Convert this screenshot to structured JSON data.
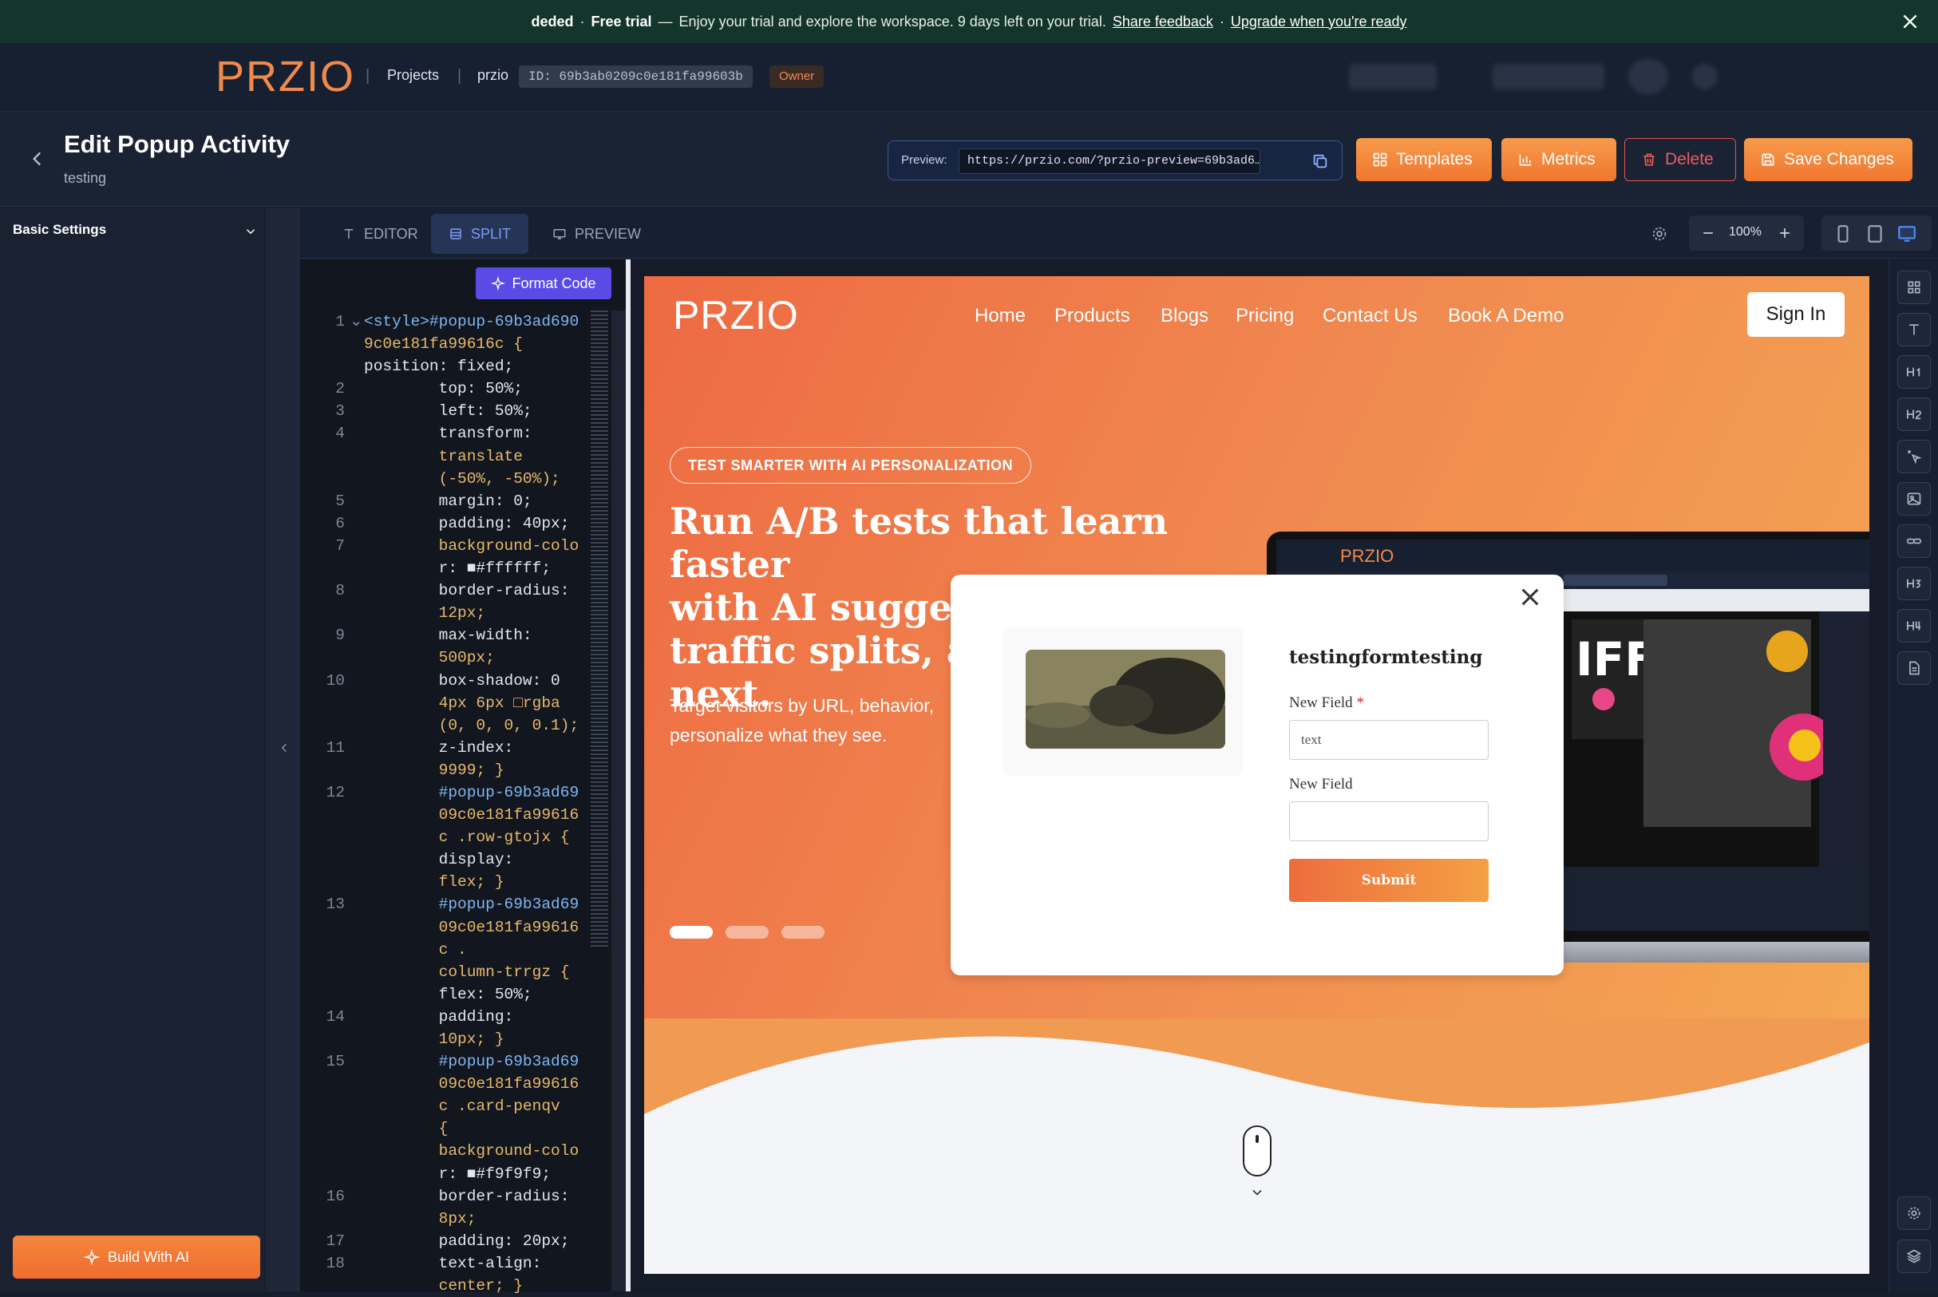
{
  "banner": {
    "workspace": "deded",
    "dot": "·",
    "trial_label": "Free trial",
    "dash": "—",
    "message": "Enjoy your trial and explore the workspace. 9 days left on your trial.",
    "feedback_link": "Share feedback",
    "middot": "·",
    "upgrade_link": "Upgrade when you're ready"
  },
  "topnav": {
    "logo": "PRZIO",
    "projects": "Projects",
    "project_name": "przio",
    "project_id": "ID: 69b3ab0209c0e181fa99603b",
    "role_badge": "Owner",
    "sep": "|"
  },
  "header": {
    "title": "Edit Popup Activity",
    "subtitle": "testing",
    "preview_label": "Preview:",
    "preview_url": "https://przio.com/?przio-preview=69b3ad6…",
    "templates": "Templates",
    "metrics": "Metrics",
    "delete": "Delete",
    "save": "Save Changes"
  },
  "sidebar": {
    "section": "Basic Settings",
    "build_ai": "Build With AI"
  },
  "tabs": {
    "editor": "EDITOR",
    "split": "SPLIT",
    "preview": "PREVIEW",
    "zoom": "100%"
  },
  "code": {
    "format_button": "Format Code",
    "lines": [
      {
        "n": "1",
        "t": "<style>#popup-69b3ad690"
      },
      {
        "n": "",
        "t": "9c0e181fa99616c {"
      },
      {
        "n": "",
        "t": "position: fixed;"
      },
      {
        "n": "2",
        "t": "        top: 50%;"
      },
      {
        "n": "3",
        "t": "        left: 50%;"
      },
      {
        "n": "4",
        "t": "        transform:"
      },
      {
        "n": "",
        "t": "        translate"
      },
      {
        "n": "",
        "t": "        (-50%, -50%);"
      },
      {
        "n": "5",
        "t": "        margin: 0;"
      },
      {
        "n": "6",
        "t": "        padding: 40px;"
      },
      {
        "n": "7",
        "t": "        background-colo"
      },
      {
        "n": "",
        "t": "        r: ■#ffffff;"
      },
      {
        "n": "8",
        "t": "        border-radius:"
      },
      {
        "n": "",
        "t": "        12px;"
      },
      {
        "n": "9",
        "t": "        max-width:"
      },
      {
        "n": "",
        "t": "        500px;"
      },
      {
        "n": "10",
        "t": "        box-shadow: 0"
      },
      {
        "n": "",
        "t": "        4px 6px □rgba"
      },
      {
        "n": "",
        "t": "        (0, 0, 0, 0.1);"
      },
      {
        "n": "11",
        "t": "        z-index:"
      },
      {
        "n": "",
        "t": "        9999; }"
      },
      {
        "n": "12",
        "t": "        #popup-69b3ad69"
      },
      {
        "n": "",
        "t": "        09c0e181fa99616"
      },
      {
        "n": "",
        "t": "        c .row-gtojx {"
      },
      {
        "n": "",
        "t": "        display:"
      },
      {
        "n": "",
        "t": "        flex; }"
      },
      {
        "n": "13",
        "t": "        #popup-69b3ad69"
      },
      {
        "n": "",
        "t": "        09c0e181fa99616"
      },
      {
        "n": "",
        "t": "        c ."
      },
      {
        "n": "",
        "t": "        column-trrgz {"
      },
      {
        "n": "",
        "t": "        flex: 50%;"
      },
      {
        "n": "14",
        "t": "        padding:"
      },
      {
        "n": "",
        "t": "        10px; }"
      },
      {
        "n": "15",
        "t": "        #popup-69b3ad69"
      },
      {
        "n": "",
        "t": "        09c0e181fa99616"
      },
      {
        "n": "",
        "t": "        c .card-penqv"
      },
      {
        "n": "",
        "t": "        {"
      },
      {
        "n": "",
        "t": "        background-colo"
      },
      {
        "n": "",
        "t": "        r: ■#f9f9f9;"
      },
      {
        "n": "16",
        "t": "        border-radius:"
      },
      {
        "n": "",
        "t": "        8px;"
      },
      {
        "n": "17",
        "t": "        padding: 20px;"
      },
      {
        "n": "18",
        "t": "        text-align:"
      },
      {
        "n": "",
        "t": "        center; }"
      }
    ]
  },
  "site": {
    "logo": "PRZIO",
    "nav": [
      "Home",
      "Products",
      "Blogs",
      "Pricing",
      "Contact Us",
      "Book A Demo"
    ],
    "signin": "Sign In",
    "badge": "TEST SMARTER WITH AI PERSONALIZATION",
    "headline_lines": [
      "Run A/B tests that learn faster",
      "with AI suggesting variants,",
      "traffic splits, an",
      "next."
    ],
    "subtext_lines": [
      "Target visitors by URL, behavior,",
      "personalize what they see."
    ]
  },
  "popup": {
    "title": "testingformtesting",
    "field1_label": "New Field",
    "required_mark": "*",
    "field1_value": "text",
    "field2_label": "New Field",
    "field2_value": "",
    "submit": "Submit"
  },
  "colors": {
    "accent": "#f0772f",
    "banner_bg": "#13352b",
    "split_tab": "#7c9cff",
    "format_btn": "#5a4be6"
  },
  "icons": [
    "close-icon",
    "back-icon",
    "copy-icon",
    "grid-icon",
    "bar-chart-icon",
    "trash-icon",
    "save-icon",
    "chevron-down-icon",
    "sparkle-icon",
    "gear-icon",
    "phone-icon",
    "tablet-icon",
    "desktop-icon",
    "layers-icon",
    "mouse-icon"
  ]
}
